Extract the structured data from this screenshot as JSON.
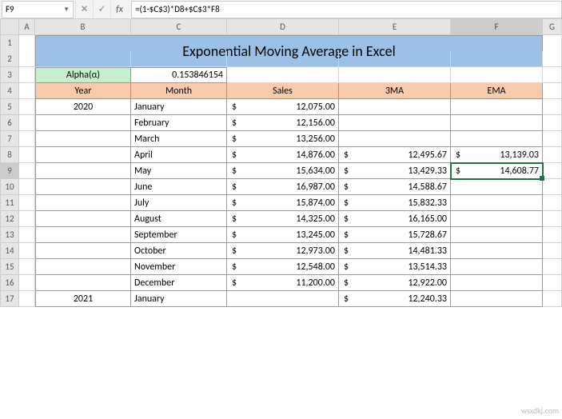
{
  "name_box": "F9",
  "formula": "=(1-$C$3)*D8+$C$3*F8",
  "columns": [
    "A",
    "B",
    "C",
    "D",
    "E",
    "F",
    "G"
  ],
  "title": "Exponential Moving Average in Excel",
  "alpha_label": "Alpha(α)",
  "alpha_value": "0.153846154",
  "headers": {
    "year": "Year",
    "month": "Month",
    "sales": "Sales",
    "ma3": "3MA",
    "ema": "EMA"
  },
  "currency": "$",
  "rows": [
    {
      "r": 5,
      "year": "2020",
      "month": "January",
      "sales": "12,075.00",
      "ma3": "",
      "ema": ""
    },
    {
      "r": 6,
      "year": "",
      "month": "February",
      "sales": "12,156.00",
      "ma3": "",
      "ema": ""
    },
    {
      "r": 7,
      "year": "",
      "month": "March",
      "sales": "13,256.00",
      "ma3": "",
      "ema": ""
    },
    {
      "r": 8,
      "year": "",
      "month": "April",
      "sales": "14,876.00",
      "ma3": "12,495.67",
      "ema": "13,139.03"
    },
    {
      "r": 9,
      "year": "",
      "month": "May",
      "sales": "15,634.00",
      "ma3": "13,429.33",
      "ema": "14,608.77"
    },
    {
      "r": 10,
      "year": "",
      "month": "June",
      "sales": "16,987.00",
      "ma3": "14,588.67",
      "ema": ""
    },
    {
      "r": 11,
      "year": "",
      "month": "July",
      "sales": "15,874.00",
      "ma3": "15,832.33",
      "ema": ""
    },
    {
      "r": 12,
      "year": "",
      "month": "August",
      "sales": "14,325.00",
      "ma3": "16,165.00",
      "ema": ""
    },
    {
      "r": 13,
      "year": "",
      "month": "September",
      "sales": "13,245.00",
      "ma3": "15,728.67",
      "ema": ""
    },
    {
      "r": 14,
      "year": "",
      "month": "October",
      "sales": "12,973.00",
      "ma3": "14,481.33",
      "ema": ""
    },
    {
      "r": 15,
      "year": "",
      "month": "November",
      "sales": "12,548.00",
      "ma3": "13,514.33",
      "ema": ""
    },
    {
      "r": 16,
      "year": "",
      "month": "December",
      "sales": "11,200.00",
      "ma3": "12,922.00",
      "ema": ""
    },
    {
      "r": 17,
      "year": "2021",
      "month": "January",
      "sales": "",
      "ma3": "12,240.33",
      "ema": ""
    }
  ],
  "selected_row": 9,
  "watermark": "wsxdkj.com"
}
